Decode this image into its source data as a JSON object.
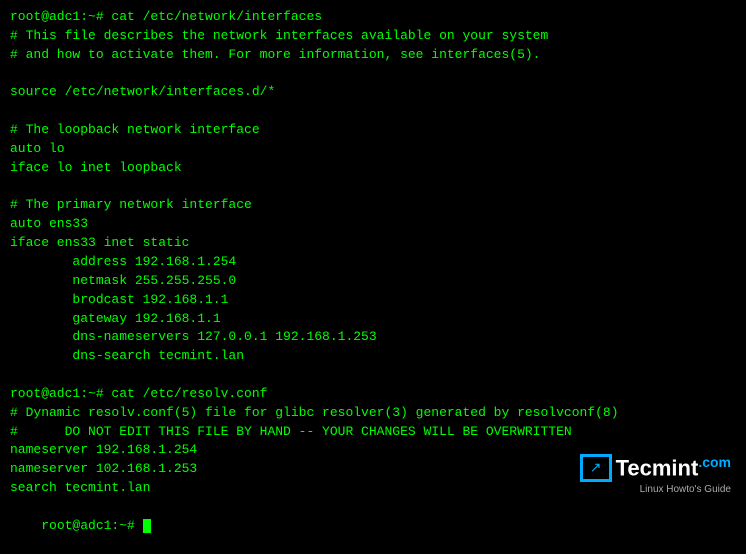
{
  "terminal": {
    "lines": [
      {
        "type": "prompt",
        "text": "root@adc1:~# cat /etc/network/interfaces"
      },
      {
        "type": "comment",
        "text": "# This file describes the network interfaces available on your system"
      },
      {
        "type": "comment",
        "text": "# and how to activate them. For more information, see interfaces(5)."
      },
      {
        "type": "blank",
        "text": ""
      },
      {
        "type": "normal",
        "text": "source /etc/network/interfaces.d/*"
      },
      {
        "type": "blank",
        "text": ""
      },
      {
        "type": "comment",
        "text": "# The loopback network interface"
      },
      {
        "type": "normal",
        "text": "auto lo"
      },
      {
        "type": "normal",
        "text": "iface lo inet loopback"
      },
      {
        "type": "blank",
        "text": ""
      },
      {
        "type": "comment",
        "text": "# The primary network interface"
      },
      {
        "type": "normal",
        "text": "auto ens33"
      },
      {
        "type": "normal",
        "text": "iface ens33 inet static"
      },
      {
        "type": "normal",
        "text": "        address 192.168.1.254"
      },
      {
        "type": "normal",
        "text": "        netmask 255.255.255.0"
      },
      {
        "type": "normal",
        "text": "        brodcast 192.168.1.1"
      },
      {
        "type": "normal",
        "text": "        gateway 192.168.1.1"
      },
      {
        "type": "normal",
        "text": "        dns-nameservers 127.0.0.1 192.168.1.253"
      },
      {
        "type": "normal",
        "text": "        dns-search tecmint.lan"
      },
      {
        "type": "blank",
        "text": ""
      },
      {
        "type": "prompt",
        "text": "root@adc1:~# cat /etc/resolv.conf"
      },
      {
        "type": "comment",
        "text": "# Dynamic resolv.conf(5) file for glibc resolver(3) generated by resolvconf(8)"
      },
      {
        "type": "warning",
        "text": "#      DO NOT EDIT THIS FILE BY HAND -- YOUR CHANGES WILL BE OVERWRITTEN"
      },
      {
        "type": "normal",
        "text": "nameserver 192.168.1.254"
      },
      {
        "type": "normal",
        "text": "nameserver 102.168.1.253"
      },
      {
        "type": "normal",
        "text": "search tecmint.lan"
      },
      {
        "type": "prompt-cursor",
        "text": "root@adc1:~# "
      }
    ]
  },
  "logo": {
    "icon_arrow": "↗",
    "name": "Tecmint",
    "dot": ".com",
    "tagline": "Linux Howto's Guide"
  }
}
